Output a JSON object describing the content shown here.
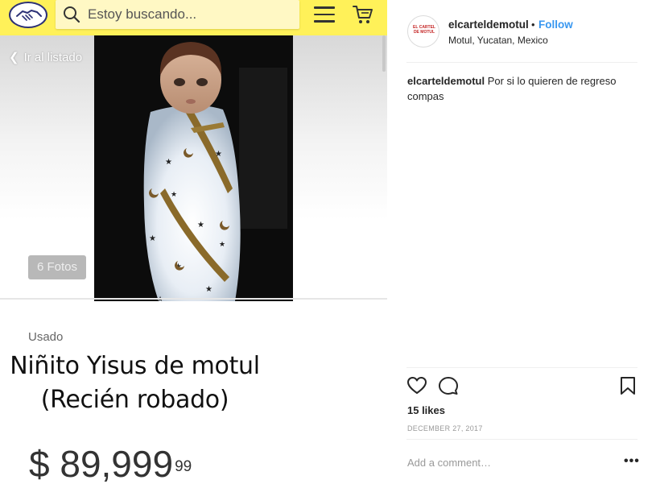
{
  "marketplace": {
    "logo_icon": "handshake-logo-icon",
    "search": {
      "placeholder": "Estoy buscando...",
      "icon": "search-icon"
    },
    "menu_icon": "hamburger-menu-icon",
    "cart_icon": "shopping-cart-icon",
    "back_label": "Ir al listado",
    "photos_badge": "6 Fotos",
    "condition": "Usado",
    "title_line1": "Niñito Yisus de motul",
    "title_line2": "(Recién robado)",
    "price_main": "$ 89,999",
    "price_cents": "99",
    "colors": {
      "brand_yellow": "#fff159",
      "search_bg": "#fff8c4"
    }
  },
  "post": {
    "username": "elcarteldemotul",
    "dot": "•",
    "follow_label": "Follow",
    "location": "Motul, Yucatan, Mexico",
    "avatar_text": "EL CARTEL DE MOTUL",
    "caption_user": "elcarteldemotul",
    "caption_text": "Por si lo quieren de regreso compas",
    "likes": "15 likes",
    "date": "DECEMBER 27, 2017",
    "comment_placeholder": "Add a comment…",
    "more_label": "•••",
    "colors": {
      "follow_blue": "#3897f0",
      "text": "#262626",
      "muted": "#999999"
    }
  }
}
